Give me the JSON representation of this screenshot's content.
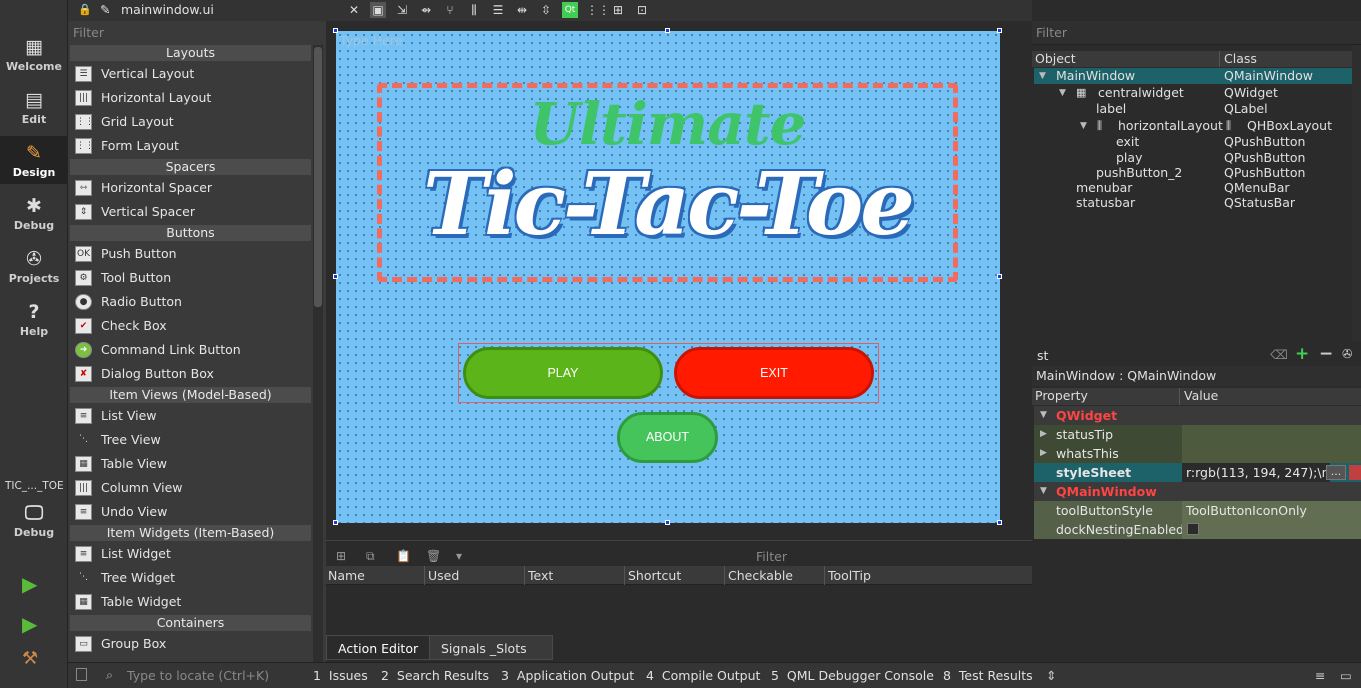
{
  "modes": [
    {
      "label": "Welcome",
      "icon": "welcome-grid-icon"
    },
    {
      "label": "Edit",
      "icon": "edit-document-icon"
    },
    {
      "label": "Design",
      "icon": "design-pencil-icon"
    },
    {
      "label": "Debug",
      "icon": "debug-bug-icon"
    },
    {
      "label": "Projects",
      "icon": "projects-wrench-icon"
    },
    {
      "label": "Help",
      "icon": "help-question-icon"
    }
  ],
  "kit": {
    "project": "TIC_..._TOE",
    "mode": "Debug"
  },
  "document": {
    "file": "mainwindow.ui"
  },
  "widgetbox": {
    "filter_placeholder": "Filter",
    "categories": {
      "layouts": "Layouts",
      "spacers": "Spacers",
      "buttons": "Buttons",
      "item_views": "Item Views (Model-Based)",
      "item_widgets": "Item Widgets (Item-Based)",
      "containers": "Containers"
    },
    "items": {
      "vertical_layout": "Vertical Layout",
      "horizontal_layout": "Horizontal Layout",
      "grid_layout": "Grid Layout",
      "form_layout": "Form Layout",
      "horizontal_spacer": "Horizontal Spacer",
      "vertical_spacer": "Vertical Spacer",
      "push_button": "Push Button",
      "tool_button": "Tool Button",
      "radio_button": "Radio Button",
      "check_box": "Check Box",
      "command_link_button": "Command Link Button",
      "dialog_button_box": "Dialog Button Box",
      "list_view": "List View",
      "tree_view": "Tree View",
      "table_view": "Table View",
      "column_view": "Column View",
      "undo_view": "Undo View",
      "list_widget": "List Widget",
      "tree_widget": "Tree Widget",
      "table_widget": "Table Widget",
      "group_box": "Group Box"
    },
    "push_icon_text": "OK"
  },
  "form": {
    "menubar_placeholder": "Type Here",
    "logo_line1": "Ultimate",
    "logo_line2": "Tic-Tac-Toe",
    "play_button": "PLAY",
    "exit_button": "EXIT",
    "about_button": "ABOUT",
    "colors": {
      "background": "#74c1f6",
      "play": "#5bb41a",
      "exit": "#ff1a00",
      "about": "#45c45c"
    }
  },
  "action_editor": {
    "filter_label": "Filter",
    "columns": [
      "Name",
      "Used",
      "Text",
      "Shortcut",
      "Checkable",
      "ToolTip"
    ],
    "tabs": [
      "Action Editor",
      "Signals _Slots E..."
    ]
  },
  "object_inspector": {
    "filter_placeholder": "Filter",
    "col_object": "Object",
    "col_class": "Class",
    "rows": [
      {
        "name": "MainWindow",
        "cls": "QMainWindow"
      },
      {
        "name": "centralwidget",
        "cls": "QWidget"
      },
      {
        "name": "label",
        "cls": "QLabel"
      },
      {
        "name": "horizontalLayout",
        "cls": "QHBoxLayout"
      },
      {
        "name": "exit",
        "cls": "QPushButton"
      },
      {
        "name": "play",
        "cls": "QPushButton"
      },
      {
        "name": "pushButton_2",
        "cls": "QPushButton"
      },
      {
        "name": "menubar",
        "cls": "QMenuBar"
      },
      {
        "name": "statusbar",
        "cls": "QStatusBar"
      }
    ]
  },
  "property_editor": {
    "filter_value": "st",
    "class_label": "MainWindow : QMainWindow",
    "col_property": "Property",
    "col_value": "Value",
    "group_widget": "QWidget",
    "status_tip": "statusTip",
    "whats_this": "whatsThis",
    "stylesheet": "styleSheet",
    "stylesheet_value": "r:rgb(113, 194, 247);\\n",
    "stylesheet_more": "...",
    "group_mainwindow": "QMainWindow",
    "tool_button_style": "toolButtonStyle",
    "tool_button_style_value": "ToolButtonIconOnly",
    "dock_nesting": "dockNestingEnabled"
  },
  "statusbar": {
    "locate_placeholder": "Type to locate (Ctrl+K)",
    "panes": [
      {
        "num": "1",
        "label": "Issues"
      },
      {
        "num": "2",
        "label": "Search Results"
      },
      {
        "num": "3",
        "label": "Application Output"
      },
      {
        "num": "4",
        "label": "Compile Output"
      },
      {
        "num": "5",
        "label": "QML Debugger Console"
      },
      {
        "num": "8",
        "label": "Test Results"
      }
    ]
  }
}
